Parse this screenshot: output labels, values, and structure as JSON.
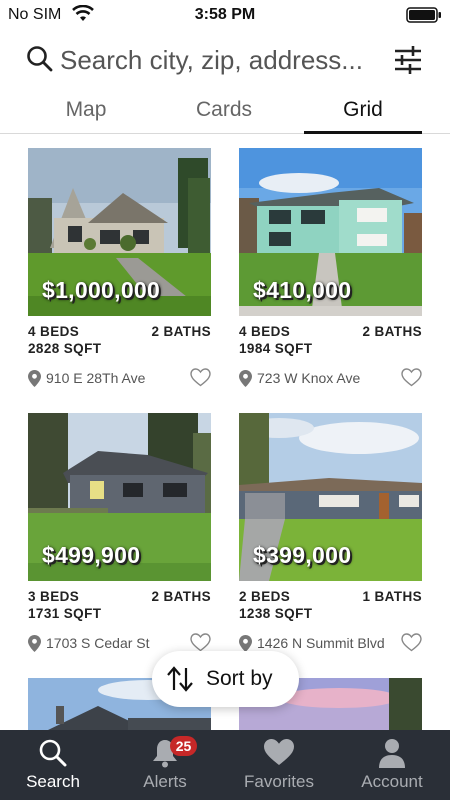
{
  "status_bar": {
    "carrier": "No SIM",
    "time": "3:58 PM"
  },
  "search": {
    "placeholder": "Search city, zip, address..."
  },
  "tabs": [
    {
      "label": "Map",
      "active": false
    },
    {
      "label": "Cards",
      "active": false
    },
    {
      "label": "Grid",
      "active": true
    }
  ],
  "listings": [
    {
      "price": "$1,000,000",
      "beds": "4 BEDS",
      "baths": "2 BATHS",
      "sqft": "2828 SQFT",
      "address": "910 E 28Th Ave"
    },
    {
      "price": "$410,000",
      "beds": "4 BEDS",
      "baths": "2 BATHS",
      "sqft": "1984 SQFT",
      "address": "723 W Knox Ave"
    },
    {
      "price": "$499,900",
      "beds": "3 BEDS",
      "baths": "2 BATHS",
      "sqft": "1731 SQFT",
      "address": "1703 S Cedar St"
    },
    {
      "price": "$399,000",
      "beds": "2 BEDS",
      "baths": "1 BATHS",
      "sqft": "1238 SQFT",
      "address": "1426 N Summit Blvd"
    }
  ],
  "sort_button": {
    "label": "Sort by"
  },
  "bottom_nav": {
    "items": [
      {
        "label": "Search",
        "icon": "search-icon",
        "active": true
      },
      {
        "label": "Alerts",
        "icon": "bell-icon",
        "badge": "25"
      },
      {
        "label": "Favorites",
        "icon": "heart-icon"
      },
      {
        "label": "Account",
        "icon": "person-icon"
      }
    ]
  },
  "colors": {
    "nav_background": "#2a2f37",
    "badge": "#c62828",
    "active_tab_underline": "#111111"
  }
}
